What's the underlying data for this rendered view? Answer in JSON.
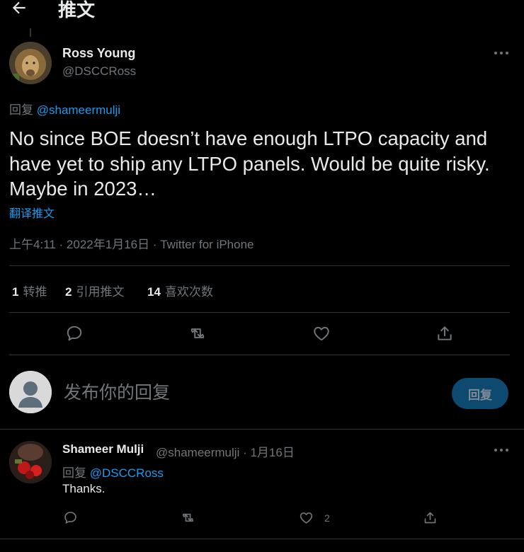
{
  "header": {
    "title": "推文",
    "back_icon": "back-arrow-icon"
  },
  "tweet": {
    "author_name": "Ross Young",
    "author_handle": "@DSCCRoss",
    "reply_to_prefix": "回复 ",
    "reply_to_handle": "@shameermulji",
    "text": "No since BOE doesn’t have enough LTPO capacity and have yet to ship any LTPO panels. Would be quite risky. Maybe in 2023…",
    "translate_label": "翻译推文",
    "timestamp": "上午4:11 · 2022年1月16日 · Twitter for iPhone"
  },
  "stats": {
    "retweets_count": "1",
    "retweets_label": "转推",
    "quotes_count": "2",
    "quotes_label": "引用推文",
    "likes_count": "14",
    "likes_label": "喜欢次数"
  },
  "compose": {
    "placeholder": "发布你的回复",
    "button_label": "回复"
  },
  "reply": {
    "author_name": "Shameer Mulji",
    "meta": "@shameermulji · 1月16日",
    "reply_to_prefix": "回复 ",
    "reply_to_handle": "@DSCCRoss",
    "text": "Thanks.",
    "like_count": "2"
  },
  "colors": {
    "accent": "#1d9bf0",
    "background": "#000000",
    "muted": "#71767b",
    "divider": "#2f3336"
  }
}
